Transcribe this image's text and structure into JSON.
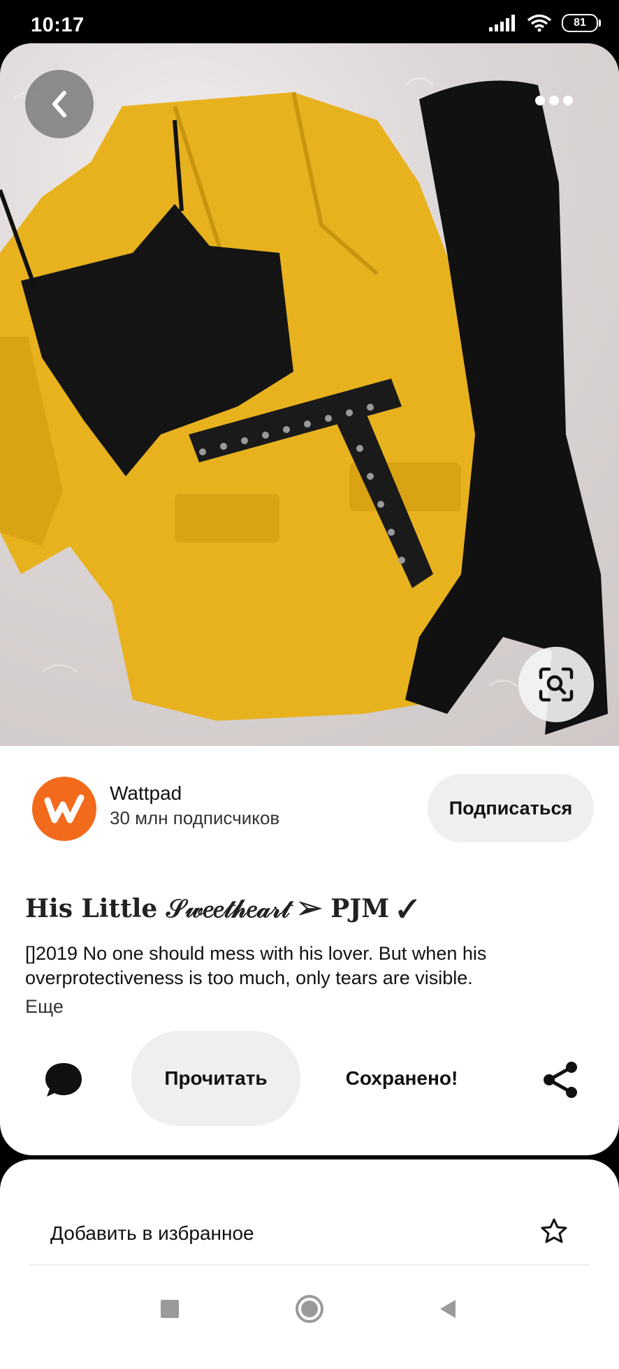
{
  "status_bar": {
    "time": "10:17",
    "battery": "81"
  },
  "publisher": {
    "name": "Wattpad",
    "followers": "30 млн подписчиков",
    "follow_label": "Подписаться"
  },
  "pin": {
    "title": "His Little 𝒮𝓌𝑒𝑒𝓉𝒽𝑒𝒶𝓇𝓉 ➢ PJM ✓",
    "description": "[]2019 No one should mess with his lover. But when his overprotectiveness is too much, only tears are visible.",
    "more_label": "Еще"
  },
  "actions": {
    "read_label": "Прочитать",
    "saved_label": "Сохранено!"
  },
  "sheet": {
    "favorite_label": "Добавить в избранное"
  },
  "colors": {
    "accent": "#f26a1b",
    "jacket": "#e8b21f",
    "button_bg": "#efefef"
  }
}
